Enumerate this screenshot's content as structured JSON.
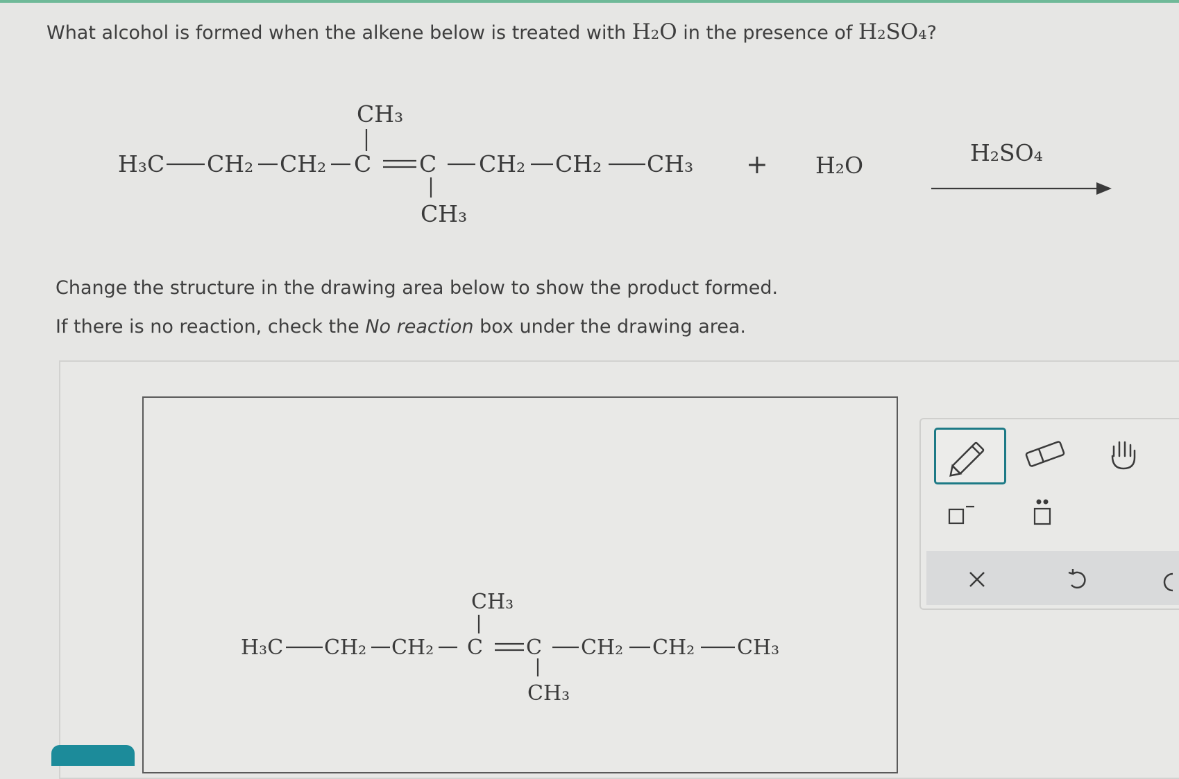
{
  "question": {
    "prefix": "What alcohol is formed when the alkene below is treated with",
    "water": "H₂O",
    "middle": "in the presence of",
    "acid": "H₂SO₄",
    "suffix": "?"
  },
  "reaction": {
    "chain_labels": [
      "H₃C",
      "CH₂",
      "CH₂",
      "C",
      "C",
      "CH₂",
      "CH₂",
      "CH₃"
    ],
    "top_substituent": "CH₃",
    "bottom_substituent": "CH₃",
    "plus": "+",
    "reagent": "H₂O",
    "catalyst": "H₂SO₄"
  },
  "instructions": {
    "line1": "Change the structure in the drawing area below to show the product formed.",
    "line2_prefix": "If there is no reaction, check the",
    "line2_italic": "No reaction",
    "line2_suffix": "box under the drawing area."
  },
  "drawing": {
    "chain_labels": [
      "H₃C",
      "CH₂",
      "CH₂",
      "C",
      "C",
      "CH₂",
      "CH₂",
      "CH₃"
    ],
    "top_substituent": "CH₃",
    "bottom_substituent": "CH₃"
  },
  "tools": {
    "items": [
      "pencil-tool",
      "eraser-tool",
      "hand-tool",
      "charge-tool",
      "lone-pair-tool",
      "clear-tool",
      "undo-tool",
      "redo-tool"
    ],
    "active": "pencil-tool",
    "accent_color": "#1d7a86"
  }
}
